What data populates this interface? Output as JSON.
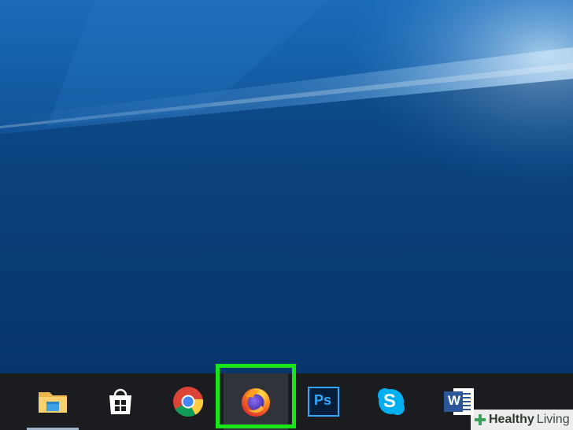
{
  "desktop": {
    "wallpaper": "windows-10-hero",
    "colors": {
      "deep": "#093a75",
      "light": "#3a8fd8"
    }
  },
  "taskbar": {
    "items": [
      {
        "name": "file-explorer",
        "icon": "folder-icon",
        "active": false,
        "running": true
      },
      {
        "name": "microsoft-store",
        "icon": "store-bag-icon",
        "active": false,
        "running": false
      },
      {
        "name": "google-chrome",
        "icon": "chrome-icon",
        "active": false,
        "running": false
      },
      {
        "name": "firefox",
        "icon": "firefox-icon",
        "active": true,
        "running": false
      },
      {
        "name": "photoshop",
        "icon": "photoshop-icon",
        "label": "Ps",
        "active": false,
        "running": false
      },
      {
        "name": "skype",
        "icon": "skype-icon",
        "label": "S",
        "active": false,
        "running": false
      },
      {
        "name": "word",
        "icon": "word-icon",
        "label": "W",
        "active": false,
        "running": false
      }
    ],
    "highlight_color": "#19e619"
  },
  "watermark": {
    "icon": "plus-icon",
    "text_bold": "Healthy",
    "text_regular": "Living"
  }
}
